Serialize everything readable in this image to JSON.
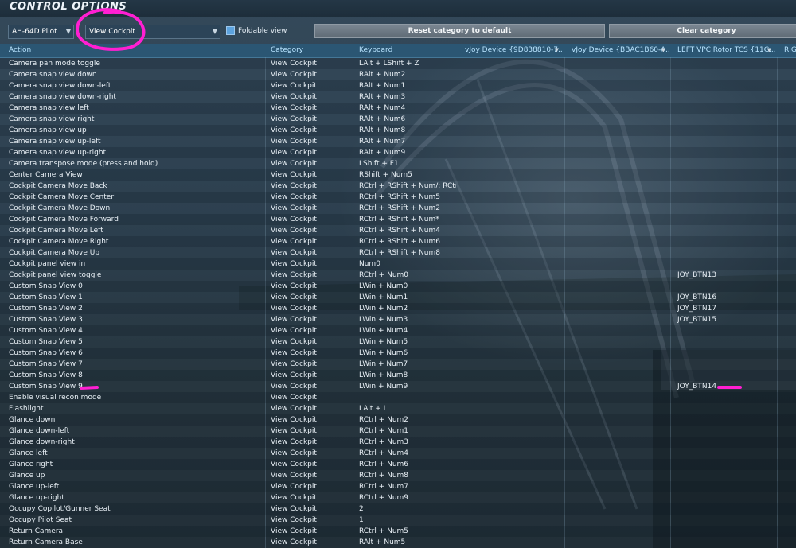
{
  "window": {
    "title": "CONTROL OPTIONS"
  },
  "toolbar": {
    "aircraft_select": "AH-64D Pilot",
    "category_select": "View Cockpit",
    "foldable_label": "Foldable view",
    "reset_label": "Reset category to default",
    "clear_label": "Clear category"
  },
  "columns": {
    "action": "Action",
    "category": "Category",
    "keyboard": "Keyboard",
    "vjoy1": "vJoy Device {9D838810-7...",
    "vjoy2": "vJoy Device {BBAC1B60-A...",
    "left_vpc": "LEFT VPC Rotor TCS {11C...",
    "right_cut": "RIGH"
  },
  "rows": [
    {
      "action": "Camera pan mode toggle",
      "category": "View Cockpit",
      "keyboard": "LAlt + LShift + Z",
      "left_vpc": ""
    },
    {
      "action": "Camera snap view down",
      "category": "View Cockpit",
      "keyboard": "RAlt + Num2",
      "left_vpc": ""
    },
    {
      "action": "Camera snap view down-left",
      "category": "View Cockpit",
      "keyboard": "RAlt + Num1",
      "left_vpc": ""
    },
    {
      "action": "Camera snap view down-right",
      "category": "View Cockpit",
      "keyboard": "RAlt + Num3",
      "left_vpc": ""
    },
    {
      "action": "Camera snap view left",
      "category": "View Cockpit",
      "keyboard": "RAlt + Num4",
      "left_vpc": ""
    },
    {
      "action": "Camera snap view right",
      "category": "View Cockpit",
      "keyboard": "RAlt + Num6",
      "left_vpc": ""
    },
    {
      "action": "Camera snap view up",
      "category": "View Cockpit",
      "keyboard": "RAlt + Num8",
      "left_vpc": ""
    },
    {
      "action": "Camera snap view up-left",
      "category": "View Cockpit",
      "keyboard": "RAlt + Num7",
      "left_vpc": ""
    },
    {
      "action": "Camera snap view up-right",
      "category": "View Cockpit",
      "keyboard": "RAlt + Num9",
      "left_vpc": ""
    },
    {
      "action": "Camera transpose mode (press and hold)",
      "category": "View Cockpit",
      "keyboard": "LShift + F1",
      "left_vpc": ""
    },
    {
      "action": "Center Camera View",
      "category": "View Cockpit",
      "keyboard": "RShift + Num5",
      "left_vpc": ""
    },
    {
      "action": "Cockpit Camera Move Back",
      "category": "View Cockpit",
      "keyboard": "RCtrl + RShift + Num/; RCtrl +",
      "left_vpc": ""
    },
    {
      "action": "Cockpit Camera Move Center",
      "category": "View Cockpit",
      "keyboard": "RCtrl + RShift + Num5",
      "left_vpc": ""
    },
    {
      "action": "Cockpit Camera Move Down",
      "category": "View Cockpit",
      "keyboard": "RCtrl + RShift + Num2",
      "left_vpc": ""
    },
    {
      "action": "Cockpit Camera Move Forward",
      "category": "View Cockpit",
      "keyboard": "RCtrl + RShift + Num*",
      "left_vpc": ""
    },
    {
      "action": "Cockpit Camera Move Left",
      "category": "View Cockpit",
      "keyboard": "RCtrl + RShift + Num4",
      "left_vpc": ""
    },
    {
      "action": "Cockpit Camera Move Right",
      "category": "View Cockpit",
      "keyboard": "RCtrl + RShift + Num6",
      "left_vpc": ""
    },
    {
      "action": "Cockpit Camera Move Up",
      "category": "View Cockpit",
      "keyboard": "RCtrl + RShift + Num8",
      "left_vpc": ""
    },
    {
      "action": "Cockpit panel view in",
      "category": "View Cockpit",
      "keyboard": "Num0",
      "left_vpc": ""
    },
    {
      "action": "Cockpit panel view toggle",
      "category": "View Cockpit",
      "keyboard": "RCtrl + Num0",
      "left_vpc": "JOY_BTN13"
    },
    {
      "action": "Custom Snap View  0",
      "category": "View Cockpit",
      "keyboard": "LWin + Num0",
      "left_vpc": ""
    },
    {
      "action": "Custom Snap View  1",
      "category": "View Cockpit",
      "keyboard": "LWin + Num1",
      "left_vpc": "JOY_BTN16"
    },
    {
      "action": "Custom Snap View  2",
      "category": "View Cockpit",
      "keyboard": "LWin + Num2",
      "left_vpc": "JOY_BTN17"
    },
    {
      "action": "Custom Snap View  3",
      "category": "View Cockpit",
      "keyboard": "LWin + Num3",
      "left_vpc": "JOY_BTN15"
    },
    {
      "action": "Custom Snap View  4",
      "category": "View Cockpit",
      "keyboard": "LWin + Num4",
      "left_vpc": ""
    },
    {
      "action": "Custom Snap View  5",
      "category": "View Cockpit",
      "keyboard": "LWin + Num5",
      "left_vpc": ""
    },
    {
      "action": "Custom Snap View  6",
      "category": "View Cockpit",
      "keyboard": "LWin + Num6",
      "left_vpc": ""
    },
    {
      "action": "Custom Snap View  7",
      "category": "View Cockpit",
      "keyboard": "LWin + Num7",
      "left_vpc": ""
    },
    {
      "action": "Custom Snap View  8",
      "category": "View Cockpit",
      "keyboard": "LWin + Num8",
      "left_vpc": ""
    },
    {
      "action": "Custom Snap View  9",
      "category": "View Cockpit",
      "keyboard": "LWin + Num9",
      "left_vpc": "JOY_BTN14"
    },
    {
      "action": "Enable visual recon mode",
      "category": "View Cockpit",
      "keyboard": "",
      "left_vpc": ""
    },
    {
      "action": "Flashlight",
      "category": "View Cockpit",
      "keyboard": "LAlt + L",
      "left_vpc": ""
    },
    {
      "action": "Glance down",
      "category": "View Cockpit",
      "keyboard": "RCtrl + Num2",
      "left_vpc": ""
    },
    {
      "action": "Glance down-left",
      "category": "View Cockpit",
      "keyboard": "RCtrl + Num1",
      "left_vpc": ""
    },
    {
      "action": "Glance down-right",
      "category": "View Cockpit",
      "keyboard": "RCtrl + Num3",
      "left_vpc": ""
    },
    {
      "action": "Glance left",
      "category": "View Cockpit",
      "keyboard": "RCtrl + Num4",
      "left_vpc": ""
    },
    {
      "action": "Glance right",
      "category": "View Cockpit",
      "keyboard": "RCtrl + Num6",
      "left_vpc": ""
    },
    {
      "action": "Glance up",
      "category": "View Cockpit",
      "keyboard": "RCtrl + Num8",
      "left_vpc": ""
    },
    {
      "action": "Glance up-left",
      "category": "View Cockpit",
      "keyboard": "RCtrl + Num7",
      "left_vpc": ""
    },
    {
      "action": "Glance up-right",
      "category": "View Cockpit",
      "keyboard": "RCtrl + Num9",
      "left_vpc": ""
    },
    {
      "action": "Occupy Copilot/Gunner Seat",
      "category": "View Cockpit",
      "keyboard": "2",
      "left_vpc": ""
    },
    {
      "action": "Occupy Pilot Seat",
      "category": "View Cockpit",
      "keyboard": "1",
      "left_vpc": ""
    },
    {
      "action": "Return Camera",
      "category": "View Cockpit",
      "keyboard": "RCtrl + Num5",
      "left_vpc": ""
    },
    {
      "action": "Return Camera Base",
      "category": "View Cockpit",
      "keyboard": "RAlt + Num5",
      "left_vpc": ""
    }
  ],
  "colors": {
    "header_bg": "#2b5673",
    "header_text": "#b9e4ff",
    "annotation": "#ff1fd2",
    "checkbox": "#5da3de"
  },
  "icons": {
    "dropdown": "chevron-down-icon",
    "checkbox": "checkbox-checked-icon"
  }
}
